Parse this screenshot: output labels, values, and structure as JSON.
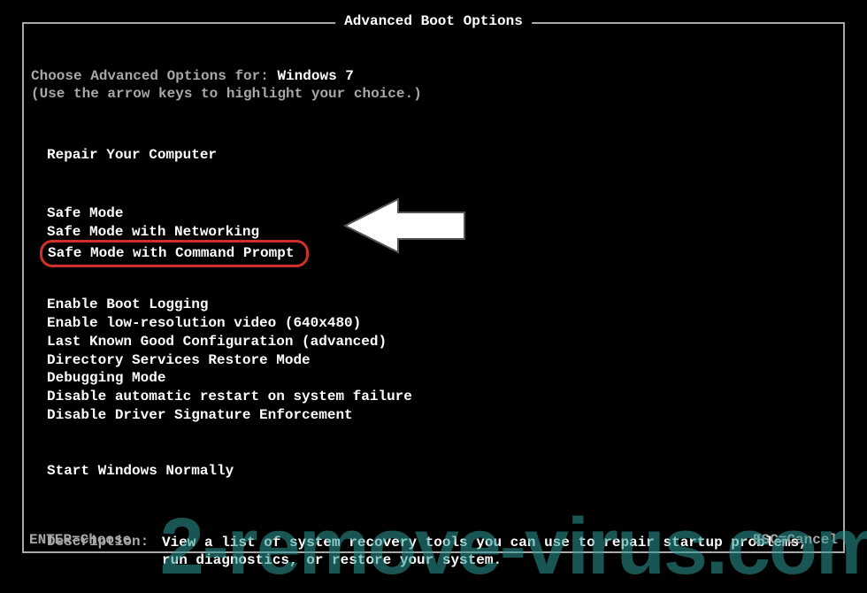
{
  "title": "Advanced Boot Options",
  "intro": {
    "prefix": "Choose Advanced Options for: ",
    "os": "Windows 7",
    "hint": "(Use the arrow keys to highlight your choice.)"
  },
  "group1": [
    "Repair Your Computer"
  ],
  "group2": [
    "Safe Mode",
    "Safe Mode with Networking",
    "Safe Mode with Command Prompt"
  ],
  "group3": [
    "Enable Boot Logging",
    "Enable low-resolution video (640x480)",
    "Last Known Good Configuration (advanced)",
    "Directory Services Restore Mode",
    "Debugging Mode",
    "Disable automatic restart on system failure",
    "Disable Driver Signature Enforcement"
  ],
  "group4": [
    "Start Windows Normally"
  ],
  "highlighted_item": "Safe Mode with Command Prompt",
  "description": {
    "label": "Description:",
    "text": "View a list of system recovery tools you can use to repair startup problems, run diagnostics, or restore your system."
  },
  "footer": {
    "left": "ENTER=Choose",
    "right": "ESC=Cancel"
  },
  "watermark": "2-remove-virus.com"
}
